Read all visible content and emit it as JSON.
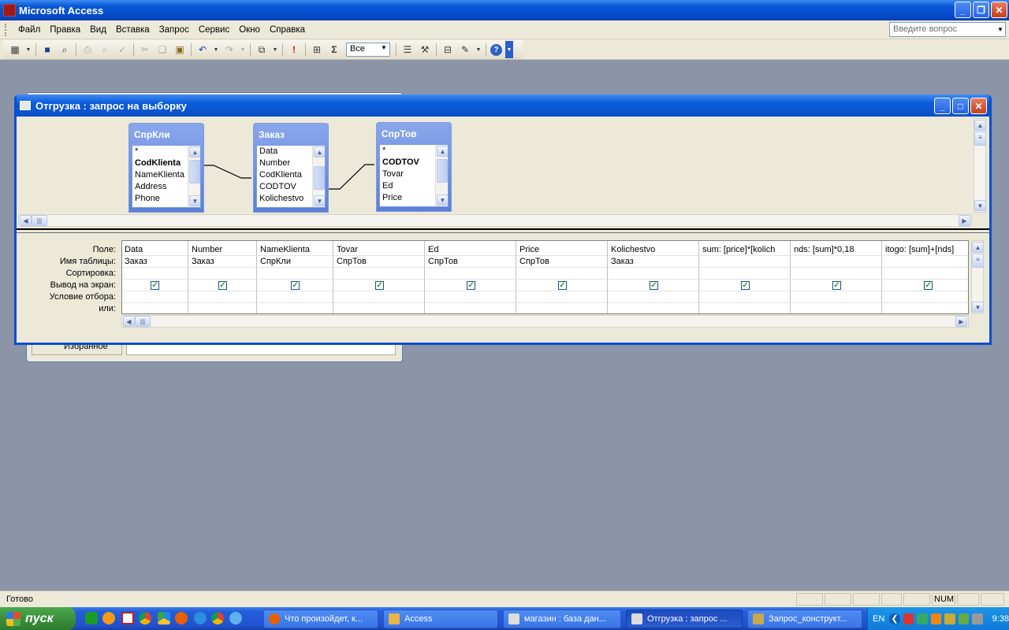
{
  "app": {
    "title": "Microsoft Access"
  },
  "menubar": {
    "items": [
      "Файл",
      "Правка",
      "Вид",
      "Вставка",
      "Запрос",
      "Сервис",
      "Окно",
      "Справка"
    ],
    "ask_placeholder": "Введите вопрос"
  },
  "toolbar": {
    "top_values": "Все"
  },
  "background_window": {
    "favorites_label": "Избранное"
  },
  "query_window": {
    "title": "Отгрузка : запрос на выборку",
    "tables": [
      {
        "name": "СпрКли",
        "fields": [
          "*",
          "CodKlienta",
          "NameKlienta",
          "Address",
          "Phone"
        ],
        "key_field": "CodKlienta"
      },
      {
        "name": "Заказ",
        "fields": [
          "Data",
          "Number",
          "CodKlienta",
          "CODTOV",
          "Kolichestvo"
        ],
        "key_field": ""
      },
      {
        "name": "СпрТов",
        "fields": [
          "*",
          "CODTOV",
          "Tovar",
          "Ed",
          "Price"
        ],
        "key_field": "CODTOV"
      }
    ],
    "grid": {
      "row_labels": [
        "Поле:",
        "Имя таблицы:",
        "Сортировка:",
        "Вывод на экран:",
        "Условие отбора:",
        "или:"
      ],
      "columns": [
        {
          "field": "Data",
          "table": "Заказ",
          "show": true
        },
        {
          "field": "Number",
          "table": "Заказ",
          "show": true
        },
        {
          "field": "NameKlienta",
          "table": "СпрКли",
          "show": true
        },
        {
          "field": "Tovar",
          "table": "СпрТов",
          "show": true
        },
        {
          "field": "Ed",
          "table": "СпрТов",
          "show": true
        },
        {
          "field": "Price",
          "table": "СпрТов",
          "show": true
        },
        {
          "field": "Kolichestvo",
          "table": "Заказ",
          "show": true
        },
        {
          "field": "sum: [price]*[kolich",
          "table": "",
          "show": true
        },
        {
          "field": "nds: [sum]*0,18",
          "table": "",
          "show": true
        },
        {
          "field": "itogo: [sum]+[nds]",
          "table": "",
          "show": true
        }
      ]
    }
  },
  "statusbar": {
    "text": "Готово",
    "num": "NUM"
  },
  "taskbar": {
    "start_label": "пуск",
    "tasks": [
      {
        "label": "Что произойдет, к...",
        "active": false
      },
      {
        "label": "Access",
        "active": false
      },
      {
        "label": "магазин : база дан...",
        "active": false
      },
      {
        "label": "Отгрузка : запрос ...",
        "active": true
      },
      {
        "label": "Запрос_конструкт...",
        "active": false
      }
    ],
    "lang": "EN",
    "clock": "9:38"
  }
}
